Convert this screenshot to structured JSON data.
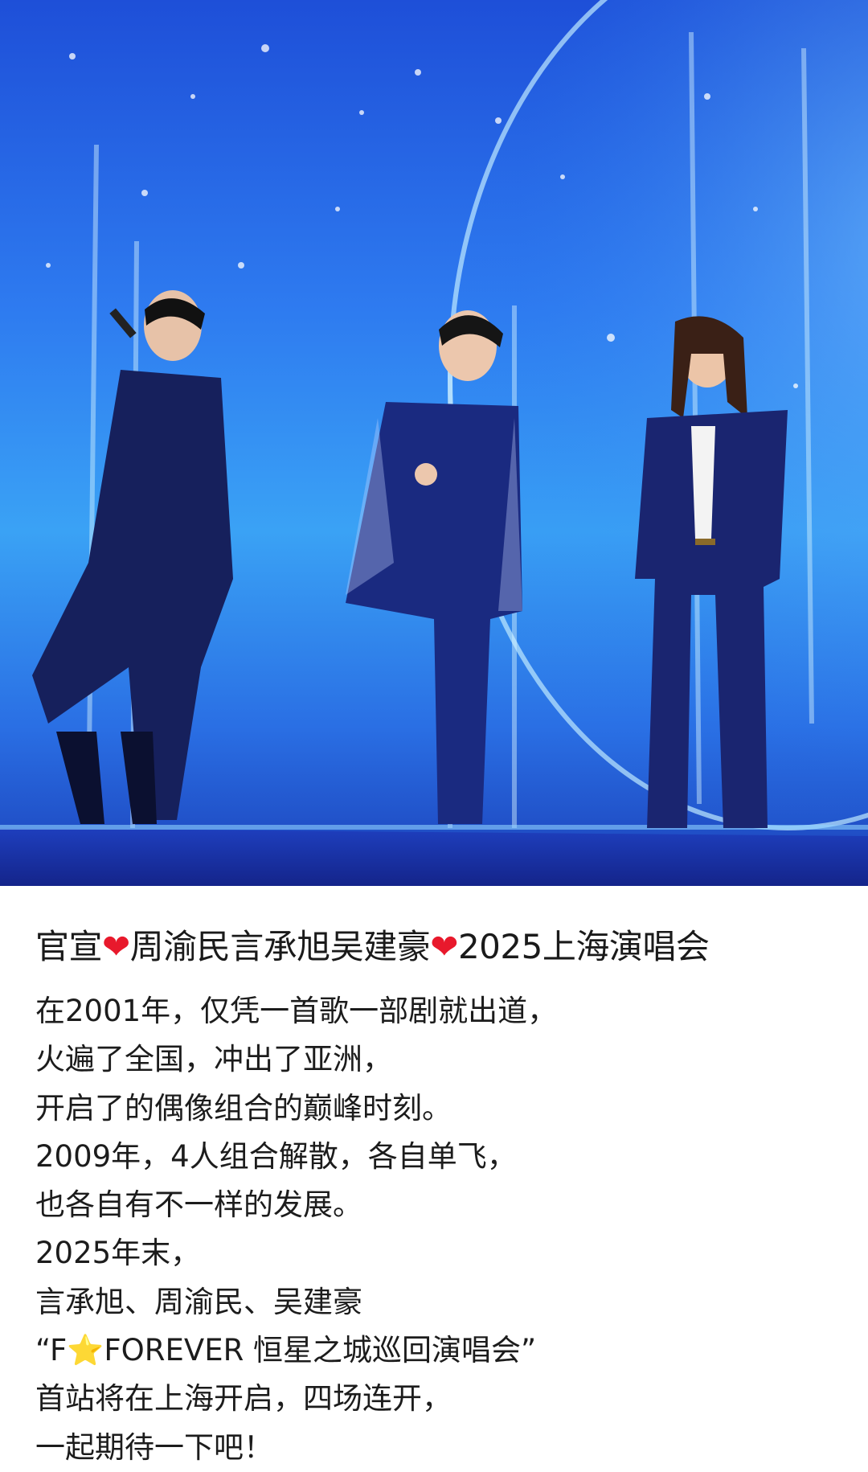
{
  "post": {
    "title_part1": "官宣",
    "title_part2": "周渝民言承旭吴建豪",
    "title_part3": "2025上海演唱会",
    "heart_icon": "❤",
    "star_icon": "⭐",
    "body_lines": [
      "在2001年，仅凭一首歌一部剧就出道，",
      "火遍了全国，冲出了亚洲，",
      "开启了的偶像组合的巅峰时刻。",
      "2009年，4人组合解散，各自单飞，",
      "也各自有不一样的发展。",
      "2025年末，",
      "言承旭、周渝民、吴建豪"
    ],
    "quote_prefix": "“F",
    "quote_suffix": "FOREVER 恒星之城巡回演唱会”",
    "closing_lines": [
      "首站将在上海开启，四场连开，",
      "一起期待一下吧！"
    ]
  },
  "colors": {
    "heart": "#e8192c",
    "star": "#f5b800",
    "stage_blue": "#2e7bf0"
  }
}
